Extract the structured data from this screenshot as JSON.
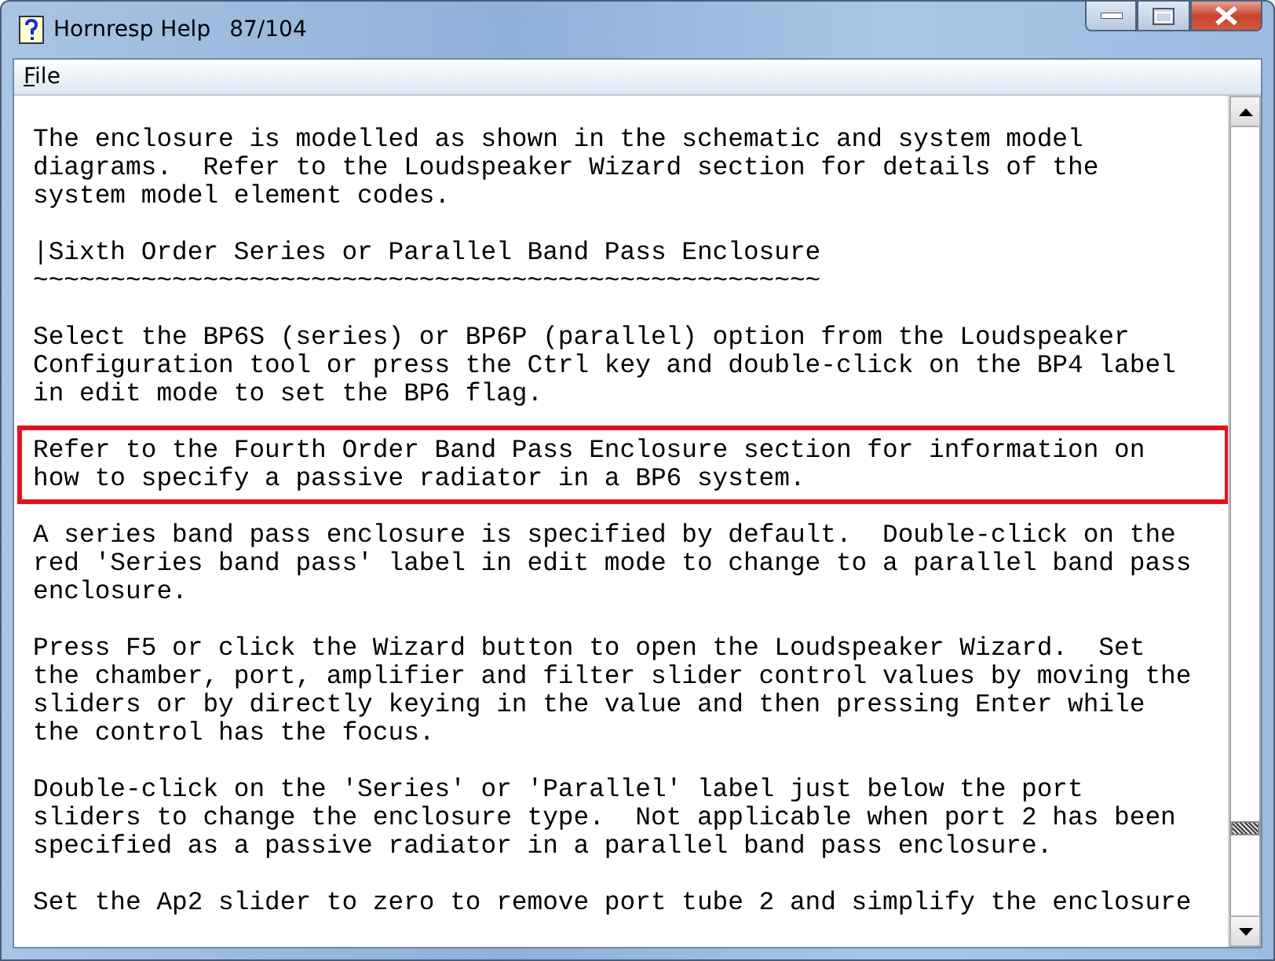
{
  "window": {
    "title": "Hornresp Help",
    "page_counter": "87/104"
  },
  "menu": [
    {
      "label": "File"
    }
  ],
  "paragraphs": [
    {
      "text": "The enclosure is modelled as shown in the schematic and system model\ndiagrams.  Refer to the Loudspeaker Wizard section for details of the\nsystem model element codes.",
      "highlighted": false
    },
    {
      "text": "|Sixth Order Series or Parallel Band Pass Enclosure\n~~~~~~~~~~~~~~~~~~~~~~~~~~~~~~~~~~~~~~~~~~~~~~~~~~~",
      "highlighted": false
    },
    {
      "text": "Select the BP6S (series) or BP6P (parallel) option from the Loudspeaker\nConfiguration tool or press the Ctrl key and double-click on the BP4 label\nin edit mode to set the BP6 flag.",
      "highlighted": false
    },
    {
      "text": "Refer to the Fourth Order Band Pass Enclosure section for information on\nhow to specify a passive radiator in a BP6 system.",
      "highlighted": true
    },
    {
      "text": "A series band pass enclosure is specified by default.  Double-click on the\nred 'Series band pass' label in edit mode to change to a parallel band pass\nenclosure.",
      "highlighted": false
    },
    {
      "text": "Press F5 or click the Wizard button to open the Loudspeaker Wizard.  Set\nthe chamber, port, amplifier and filter slider control values by moving the\nsliders or by directly keying in the value and then pressing Enter while\nthe control has the focus.",
      "highlighted": false
    },
    {
      "text": "Double-click on the 'Series' or 'Parallel' label just below the port\nsliders to change the enclosure type.  Not applicable when port 2 has been\nspecified as a passive radiator in a parallel band pass enclosure.",
      "highlighted": false
    },
    {
      "text": "Set the Ap2 slider to zero to remove port tube 2 and simplify the enclosure",
      "highlighted": false
    }
  ]
}
